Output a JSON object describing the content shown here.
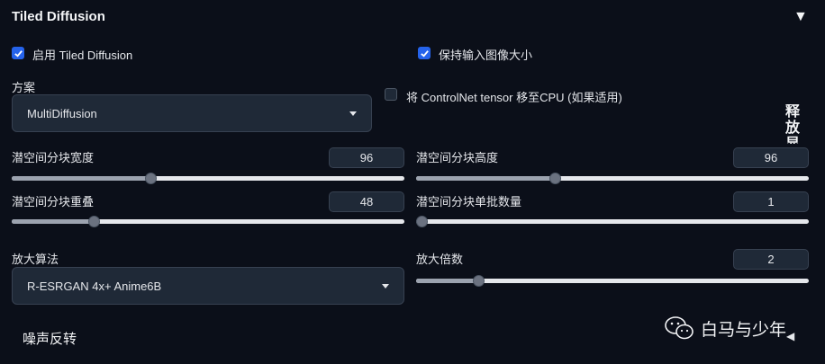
{
  "panel": {
    "title": "Tiled Diffusion"
  },
  "checkboxes": {
    "enable": {
      "label": "启用 Tiled Diffusion",
      "checked": true
    },
    "keep_size": {
      "label": "保持输入图像大小",
      "checked": true
    },
    "move_controlnet": {
      "label": "将 ControlNet tensor 移至CPU (如果适用)",
      "checked": false
    }
  },
  "method": {
    "label": "方案",
    "value": "MultiDiffusion"
  },
  "side_button": {
    "label": "释放显"
  },
  "sliders": {
    "tile_width": {
      "label": "潜空间分块宽度",
      "value": "96",
      "fraction": 0.35
    },
    "tile_height": {
      "label": "潜空间分块高度",
      "value": "96",
      "fraction": 0.35
    },
    "tile_overlap": {
      "label": "潜空间分块重叠",
      "value": "48",
      "fraction": 0.2
    },
    "tile_batch": {
      "label": "潜空间分块单批数量",
      "value": "1",
      "fraction": 0.0
    },
    "upscale_factor": {
      "label": "放大倍数",
      "value": "2",
      "fraction": 0.15
    }
  },
  "upscaler": {
    "label": "放大算法",
    "value": "R-ESRGAN 4x+ Anime6B"
  },
  "noise_inversion": {
    "label": "噪声反转"
  },
  "watermark": {
    "text": "白马与少年"
  }
}
